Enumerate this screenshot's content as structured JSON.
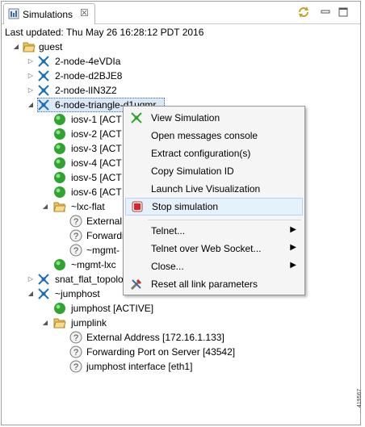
{
  "tab": {
    "title": "Simulations",
    "close_glyph": "☒"
  },
  "toolbar": {
    "refresh_icon": "refresh-icon",
    "minimize_icon": "minimize-icon",
    "maximize_icon": "maximize-icon"
  },
  "status": {
    "last_updated": "Last updated: Thu May 26 16:28:12 PDT 2016"
  },
  "tree": {
    "guest": "guest",
    "sim1": "2-node-4eVDIa",
    "sim2": "2-node-d2BJE8",
    "sim3": "2-node-lIN3Z2",
    "sim4": "6-node-triangle-d1uqmr",
    "iosv1": "iosv-1  [ACT",
    "iosv2": "iosv-2  [ACT",
    "iosv3": "iosv-3  [ACT",
    "iosv4": "iosv-4  [ACT",
    "iosv5": "iosv-5  [ACT",
    "iosv6": "iosv-6  [ACT",
    "lxc_flat": "~lxc-flat",
    "external": "External",
    "forwarding": "Forwardi",
    "mgmt_iface": "~mgmt-",
    "mgmt_lxc": "~mgmt-lxc",
    "snat": "snat_flat_topolo",
    "jumphost_sim": "~jumphost",
    "jumphost": "jumphost  [ACTIVE]",
    "jumplink": "jumplink",
    "ext_addr": "External Address  [172.16.1.133]",
    "fwd_port": "Forwarding Port on Server  [43542]",
    "jh_iface": "jumphost interface  [eth1]"
  },
  "context_menu": {
    "view_simulation": "View Simulation",
    "open_console": "Open messages console",
    "extract_config": "Extract configuration(s)",
    "copy_id": "Copy Simulation ID",
    "launch_live": "Launch Live Visualization",
    "stop_simulation": "Stop simulation",
    "telnet": "Telnet...",
    "telnet_ws": "Telnet over Web Socket...",
    "close": "Close...",
    "reset_links": "Reset all link parameters",
    "submenu_arrow": "▶"
  },
  "colors": {
    "active_green": "#2fa52f",
    "stop_red": "#d9262b",
    "folder_yellow": "#e9c35a",
    "sim_blue": "#1d6fb8",
    "selection": "#dbe8f7"
  },
  "watermark": "419567"
}
